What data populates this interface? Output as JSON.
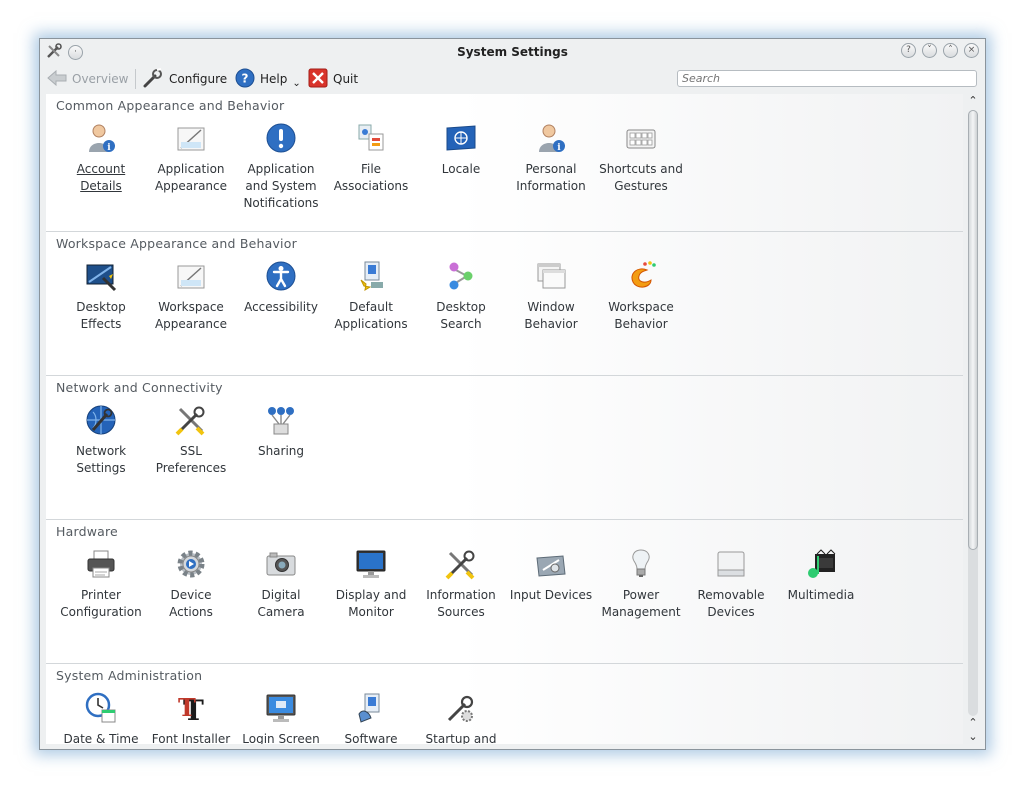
{
  "window": {
    "title": "System Settings"
  },
  "toolbar": {
    "overview": "Overview",
    "configure": "Configure",
    "help": "Help",
    "quit": "Quit",
    "search_placeholder": "Search"
  },
  "sections": [
    {
      "title": "Common Appearance and Behavior",
      "items": [
        {
          "label": "Account Details",
          "icon": "account-icon"
        },
        {
          "label": "Application Appearance",
          "icon": "appearance-icon"
        },
        {
          "label": "Application and System Notifications",
          "icon": "notification-icon"
        },
        {
          "label": "File Associations",
          "icon": "file-associations-icon"
        },
        {
          "label": "Locale",
          "icon": "locale-flag-icon"
        },
        {
          "label": "Personal Information",
          "icon": "personal-info-icon"
        },
        {
          "label": "Shortcuts and Gestures",
          "icon": "keyboard-icon"
        }
      ]
    },
    {
      "title": "Workspace Appearance and Behavior",
      "items": [
        {
          "label": "Desktop Effects",
          "icon": "desktop-effects-icon"
        },
        {
          "label": "Workspace Appearance",
          "icon": "appearance-icon"
        },
        {
          "label": "Accessibility",
          "icon": "accessibility-icon"
        },
        {
          "label": "Default Applications",
          "icon": "default-apps-icon"
        },
        {
          "label": "Desktop Search",
          "icon": "desktop-search-icon"
        },
        {
          "label": "Window Behavior",
          "icon": "window-icon"
        },
        {
          "label": "Workspace Behavior",
          "icon": "workspace-behavior-icon"
        }
      ]
    },
    {
      "title": "Network and Connectivity",
      "items": [
        {
          "label": "Network Settings",
          "icon": "globe-wrench-icon"
        },
        {
          "label": "SSL Preferences",
          "icon": "tools-icon"
        },
        {
          "label": "Sharing",
          "icon": "sharing-icon"
        }
      ]
    },
    {
      "title": "Hardware",
      "items": [
        {
          "label": "Printer Configuration",
          "icon": "printer-icon"
        },
        {
          "label": "Device Actions",
          "icon": "gear-icon"
        },
        {
          "label": "Digital Camera",
          "icon": "camera-icon"
        },
        {
          "label": "Display and Monitor",
          "icon": "monitor-icon"
        },
        {
          "label": "Information Sources",
          "icon": "tools-icon"
        },
        {
          "label": "Input Devices",
          "icon": "input-devices-icon"
        },
        {
          "label": "Power Management",
          "icon": "lightbulb-icon"
        },
        {
          "label": "Removable Devices",
          "icon": "removable-drive-icon"
        },
        {
          "label": "Multimedia",
          "icon": "multimedia-icon"
        }
      ]
    },
    {
      "title": "System Administration",
      "items": [
        {
          "label": "Date & Time",
          "icon": "clock-calendar-icon"
        },
        {
          "label": "Font Installer",
          "icon": "font-icon"
        },
        {
          "label": "Login Screen",
          "icon": "login-screen-icon"
        },
        {
          "label": "Software",
          "icon": "software-icon"
        },
        {
          "label": "Startup and",
          "icon": "startup-icon"
        }
      ]
    }
  ],
  "colors": {
    "window_glow": "#6ea0cd",
    "text": "#31363b",
    "section_title": "#555b61"
  }
}
